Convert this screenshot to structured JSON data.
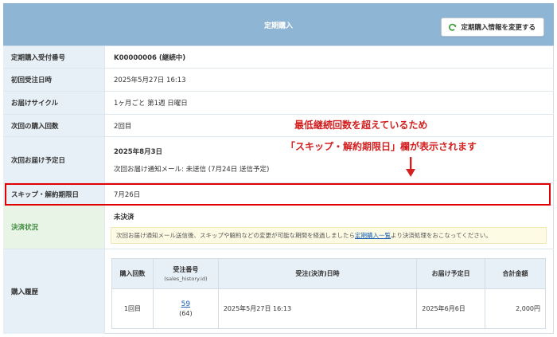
{
  "header": {
    "title": "定期購入",
    "change_button_label": "定期購入情報を変更する"
  },
  "rows": {
    "reception_no": {
      "label": "定期購入受付番号",
      "value": "K00000006 (継続中)"
    },
    "first_order_date": {
      "label": "初回受注日時",
      "value": "2025年5月27日 16:13"
    },
    "delivery_cycle": {
      "label": "お届けサイクル",
      "value": "1ヶ月ごと 第1週 日曜日"
    },
    "next_count": {
      "label": "次回の購入回数",
      "value": "2回目"
    },
    "next_delivery": {
      "label": "次回お届け予定日",
      "value": "2025年8月3日",
      "sub": "次回お届け通知メール: 未送信 (7月24日 送信予定)"
    },
    "skip_limit": {
      "label": "スキップ・解約期限日",
      "value": "7月26日"
    },
    "payment": {
      "label": "決済状況",
      "value": "未決済",
      "notice_before": "次回お届け通知メール送信後、スキップや解約などの変更が可能な期間を経過しましたら",
      "notice_link": "定期購入一覧",
      "notice_after": "より決済処理をおこなってください。"
    },
    "history": {
      "label": "購入履歴"
    }
  },
  "annotation": {
    "line1": "最低継続回数を超えているため",
    "line2": "「スキップ・解約期限日」欄が表示されます"
  },
  "history_table": {
    "headers": {
      "count": "購入回数",
      "order_no": "受注番号",
      "order_no_sub": "(sales_history.id)",
      "order_date": "受注(決済)日時",
      "delivery_date": "お届け予定日",
      "total": "合計金額"
    },
    "rows": [
      {
        "count": "1回目",
        "order_no": "59",
        "order_no_sub": "(64)",
        "order_date": "2025年5月27日 16:13",
        "delivery_date": "2025年6月6日",
        "total": "2,000円"
      }
    ]
  },
  "colors": {
    "header_bg": "#8fb5d5",
    "label_bg": "#e7eff7",
    "highlight": "#e00000",
    "annotation": "#d32020",
    "link": "#1a5fb4"
  },
  "icons": {
    "change_button": "refresh-icon",
    "annotation_arrow": "arrow-down-icon"
  }
}
